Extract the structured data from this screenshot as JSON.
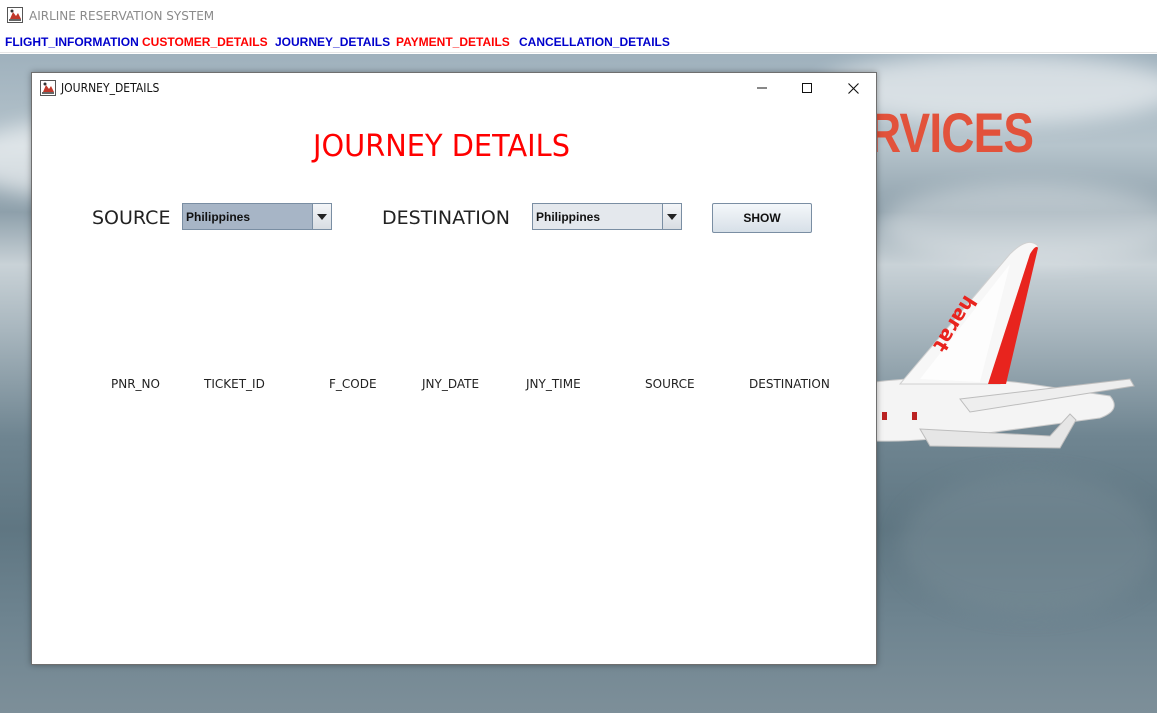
{
  "app": {
    "title": "AIRLINE RESERVATION SYSTEM"
  },
  "menu": [
    {
      "label": "FLIGHT_INFORMATION",
      "color": "#0000cc"
    },
    {
      "label": "CUSTOMER_DETAILS",
      "color": "#ff0000"
    },
    {
      "label": "JOURNEY_DETAILS",
      "color": "#0000cc"
    },
    {
      "label": "PAYMENT_DETAILS",
      "color": "#ff0000"
    },
    {
      "label": "CANCELLATION_DETAILS",
      "color": "#0000cc"
    }
  ],
  "background": {
    "banner_text": "RVICES"
  },
  "dialog": {
    "title": "JOURNEY_DETAILS",
    "heading": "JOURNEY DETAILS",
    "heading_color": "#ff0000",
    "source_label": "SOURCE",
    "source_value": "Philippines",
    "destination_label": "DESTINATION",
    "destination_value": "Philippines",
    "show_button": "SHOW",
    "table_headers": [
      "PNR_NO",
      "TICKET_ID",
      "F_CODE",
      "JNY_DATE",
      "JNY_TIME",
      "SOURCE",
      "DESTINATION"
    ]
  },
  "icons": {
    "app": "java-cup-icon",
    "minimize": "minimize-icon",
    "maximize": "maximize-icon",
    "close": "close-icon",
    "dropdown": "chevron-down-icon"
  }
}
